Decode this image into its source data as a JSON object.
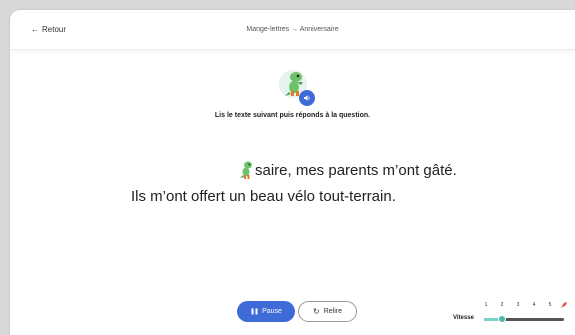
{
  "header": {
    "back_label": "Retour",
    "breadcrumb": "Mange-lettres → Anniversaire"
  },
  "main": {
    "instruction": "Lis le texte suivant puis réponds à la question.",
    "line1": "saire, mes parents m’ont gâté.",
    "line2": "Ils m’ont offert un beau vélo tout-terrain."
  },
  "controls": {
    "pause_label": "Pause",
    "replay_label": "Relire"
  },
  "speed": {
    "label": "Vitesse",
    "ticks": [
      "1",
      "2",
      "3",
      "4",
      "5"
    ],
    "value": 2
  },
  "icons": {
    "back": "arrow-left-icon",
    "mascot": "dinosaur-icon",
    "audio": "speaker-icon",
    "pause": "pause-icon",
    "replay": "replay-icon",
    "speed_max": "rocket-icon"
  },
  "colors": {
    "accent": "#3f6bd8",
    "slider": "#4fb7ac"
  }
}
